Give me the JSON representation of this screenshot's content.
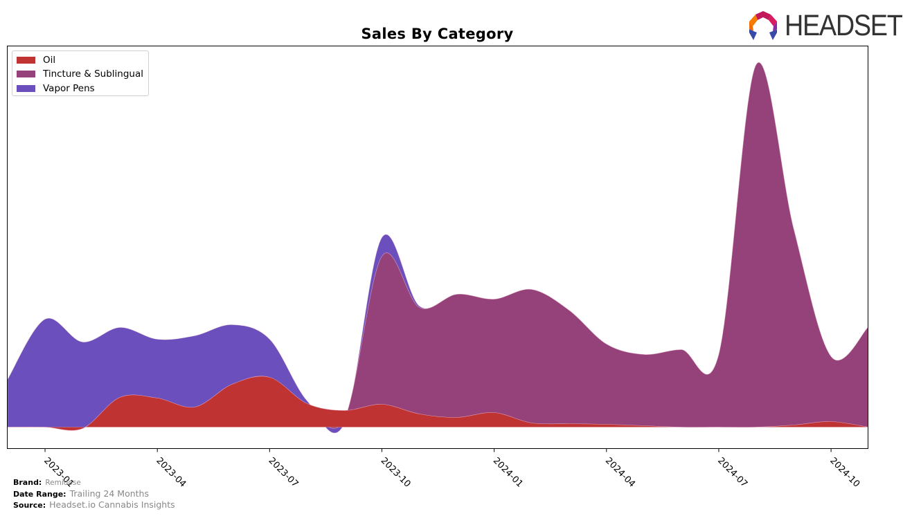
{
  "header": {
    "logo_text": "HEADSET"
  },
  "footer": {
    "brand_label": "Brand:",
    "brand_value": "Remidose",
    "date_range_label": "Date Range:",
    "date_range_value": "Trailing 24 Months",
    "source_label": "Source:",
    "source_value": "Headset.io Cannabis Insights"
  },
  "chart_data": {
    "type": "area",
    "stacked": true,
    "smoothed": true,
    "title": "Sales By Category",
    "xlabel": "",
    "ylabel": "",
    "y_axis_labels_shown": false,
    "grid": false,
    "legend_position": "top-left",
    "x": [
      "2022-12",
      "2023-01",
      "2023-02",
      "2023-03",
      "2023-04",
      "2023-05",
      "2023-06",
      "2023-07",
      "2023-08",
      "2023-09",
      "2023-10",
      "2023-11",
      "2023-12",
      "2024-01",
      "2024-02",
      "2024-03",
      "2024-04",
      "2024-05",
      "2024-06",
      "2024-07",
      "2024-08",
      "2024-09",
      "2024-10",
      "2024-11"
    ],
    "x_ticks": [
      "2023-01",
      "2023-04",
      "2023-07",
      "2023-10",
      "2024-01",
      "2024-04",
      "2024-07",
      "2024-10"
    ],
    "ylim": [
      -31,
      551
    ],
    "series": [
      {
        "name": "Oil",
        "color": "#c03333",
        "values": [
          0,
          0,
          -2,
          43,
          42,
          29,
          62,
          72,
          34,
          24,
          33,
          19,
          14,
          21,
          6,
          5,
          4,
          2,
          0,
          0,
          0,
          3,
          8,
          0
        ]
      },
      {
        "name": "Tincture & Sublingual",
        "color": "#96427a",
        "values": [
          0,
          0,
          0,
          0,
          0,
          0,
          0,
          0,
          -4,
          -12,
          214,
          154,
          178,
          164,
          193,
          164,
          116,
          103,
          112,
          105,
          524,
          284,
          94,
          145
        ]
      },
      {
        "name": "Vapor Pens",
        "color": "#6a4fbd",
        "values": [
          69,
          156,
          125,
          101,
          85,
          103,
          86,
          55,
          8,
          -6,
          27,
          2,
          0,
          0,
          0,
          0,
          0,
          0,
          0,
          0,
          0,
          0,
          0,
          0
        ]
      }
    ]
  }
}
